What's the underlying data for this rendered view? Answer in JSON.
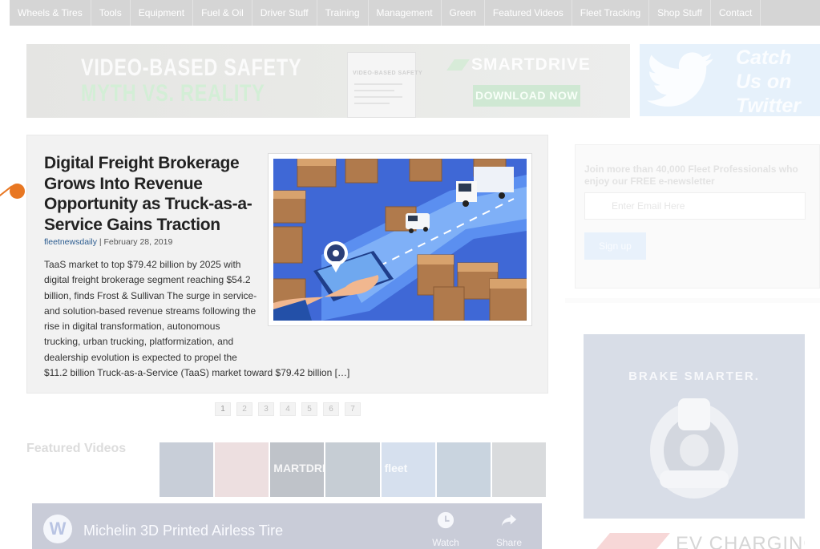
{
  "nav": {
    "items": [
      "Wheels & Tires",
      "Tools",
      "Equipment",
      "Fuel & Oil",
      "Driver Stuff",
      "Training",
      "Management",
      "Green",
      "Featured Videos",
      "Fleet Tracking",
      "Shop Stuff",
      "Contact"
    ]
  },
  "banner_ad": {
    "headline_line1": "VIDEO-BASED SAFETY",
    "headline_line2": "MYTH VS. REALITY",
    "doc_title": "VIDEO-BASED SAFETY",
    "brand": "SMARTDRIVE",
    "cta": "DOWNLOAD NOW"
  },
  "twitter_ad": {
    "text": "Catch\nUs on\nTwitter"
  },
  "article": {
    "title": "Digital Freight Brokerage Grows Into Revenue Opportunity as Truck-as-a-Service Gains Traction",
    "author": "fleetnewsdaily",
    "separator": " | ",
    "date": "February 28, 2019",
    "excerpt": "TaaS market to top $79.42 billion by 2025 with digital freight brokerage segment reaching $54.2 billion, finds Frost & Sullivan The surge in service- and solution-based revenue streams following the rise in digital transformation, autonomous trucking, urban trucking, platformization, and dealership evolution is expected to propel the $11.2 billion Truck-as-a-Service (TaaS) market toward $79.42 billion […]"
  },
  "pagination": {
    "pages": [
      "1",
      "2",
      "3",
      "4",
      "5",
      "6",
      "7"
    ],
    "current": "1"
  },
  "featured_videos": {
    "title": "Featured Videos",
    "thumbs": [
      {
        "label": "",
        "color": "#c8ced8"
      },
      {
        "label": "",
        "color": "#eddfe0"
      },
      {
        "label": "MARTDRI",
        "color": "#bfc3c9"
      },
      {
        "label": "",
        "color": "#c6cdd4"
      },
      {
        "label": "fleet",
        "color": "#d6e0ee"
      },
      {
        "label": "",
        "color": "#c9d4df"
      },
      {
        "label": "",
        "color": "#d9dbdd"
      }
    ]
  },
  "video_player": {
    "logo": "W",
    "title": "Michelin 3D Printed Airless Tire",
    "watch_later": "Watch later",
    "share": "Share"
  },
  "newsletter": {
    "text": "Join more than 40,000 Fleet Professionals who enjoy our FREE e-newsletter",
    "placeholder": "Enter Email Here",
    "button": "Sign up"
  },
  "sidebar_ad": {
    "headline": "BRAKE SMARTER."
  },
  "sidebar_ad2": {
    "text": "EV CHARGING"
  }
}
